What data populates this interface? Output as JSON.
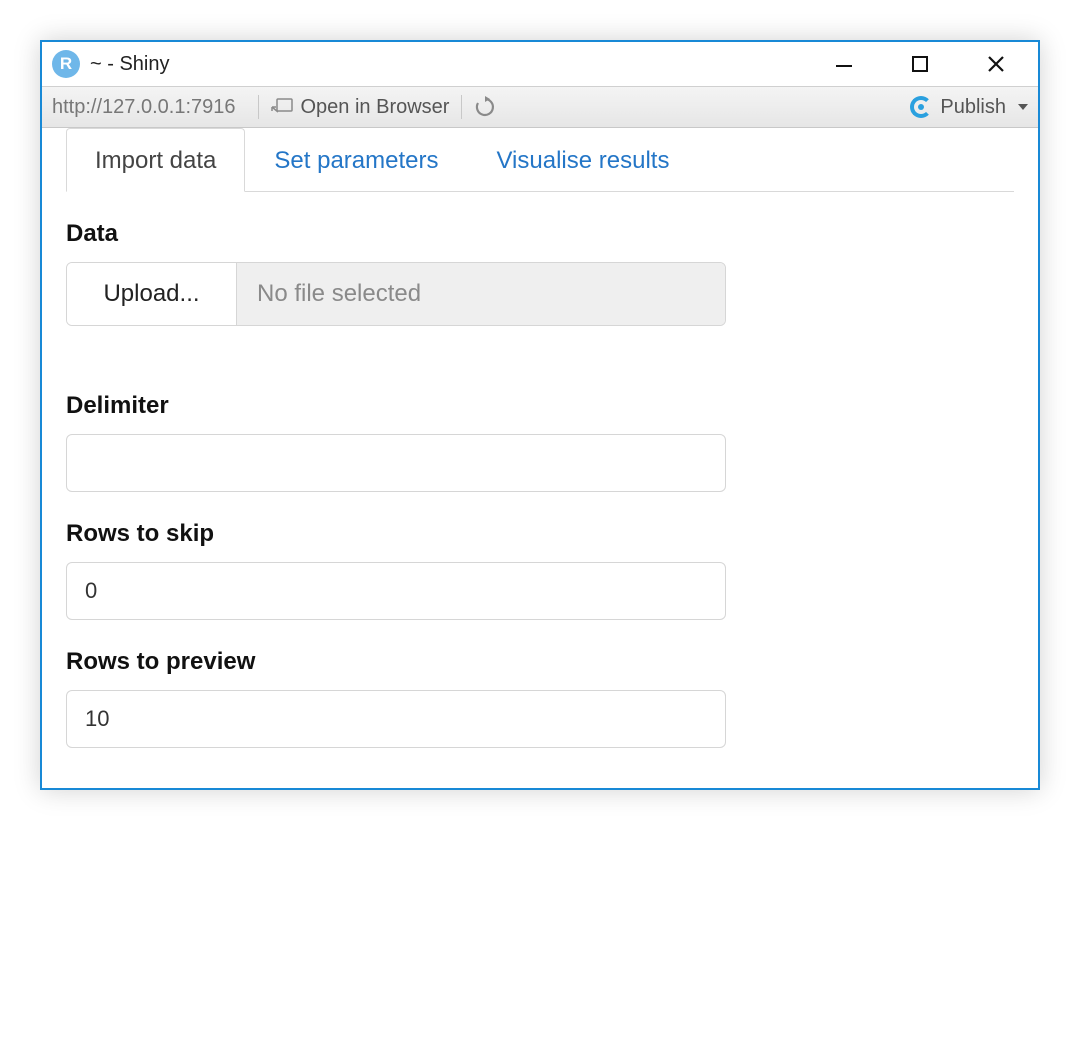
{
  "window": {
    "title": "~ - Shiny",
    "icon_letter": "R"
  },
  "toolbar": {
    "address": "http://127.0.0.1:7916",
    "open_in_browser": "Open in Browser",
    "publish": "Publish"
  },
  "tabs": {
    "items": [
      {
        "label": "Import data",
        "active": true
      },
      {
        "label": "Set parameters",
        "active": false
      },
      {
        "label": "Visualise results",
        "active": false
      }
    ]
  },
  "form": {
    "data_label": "Data",
    "upload_button": "Upload...",
    "upload_placeholder": "No file selected",
    "delimiter_label": "Delimiter",
    "delimiter_value": "",
    "rows_to_skip_label": "Rows to skip",
    "rows_to_skip_value": "0",
    "rows_to_preview_label": "Rows to preview",
    "rows_to_preview_value": "10"
  }
}
